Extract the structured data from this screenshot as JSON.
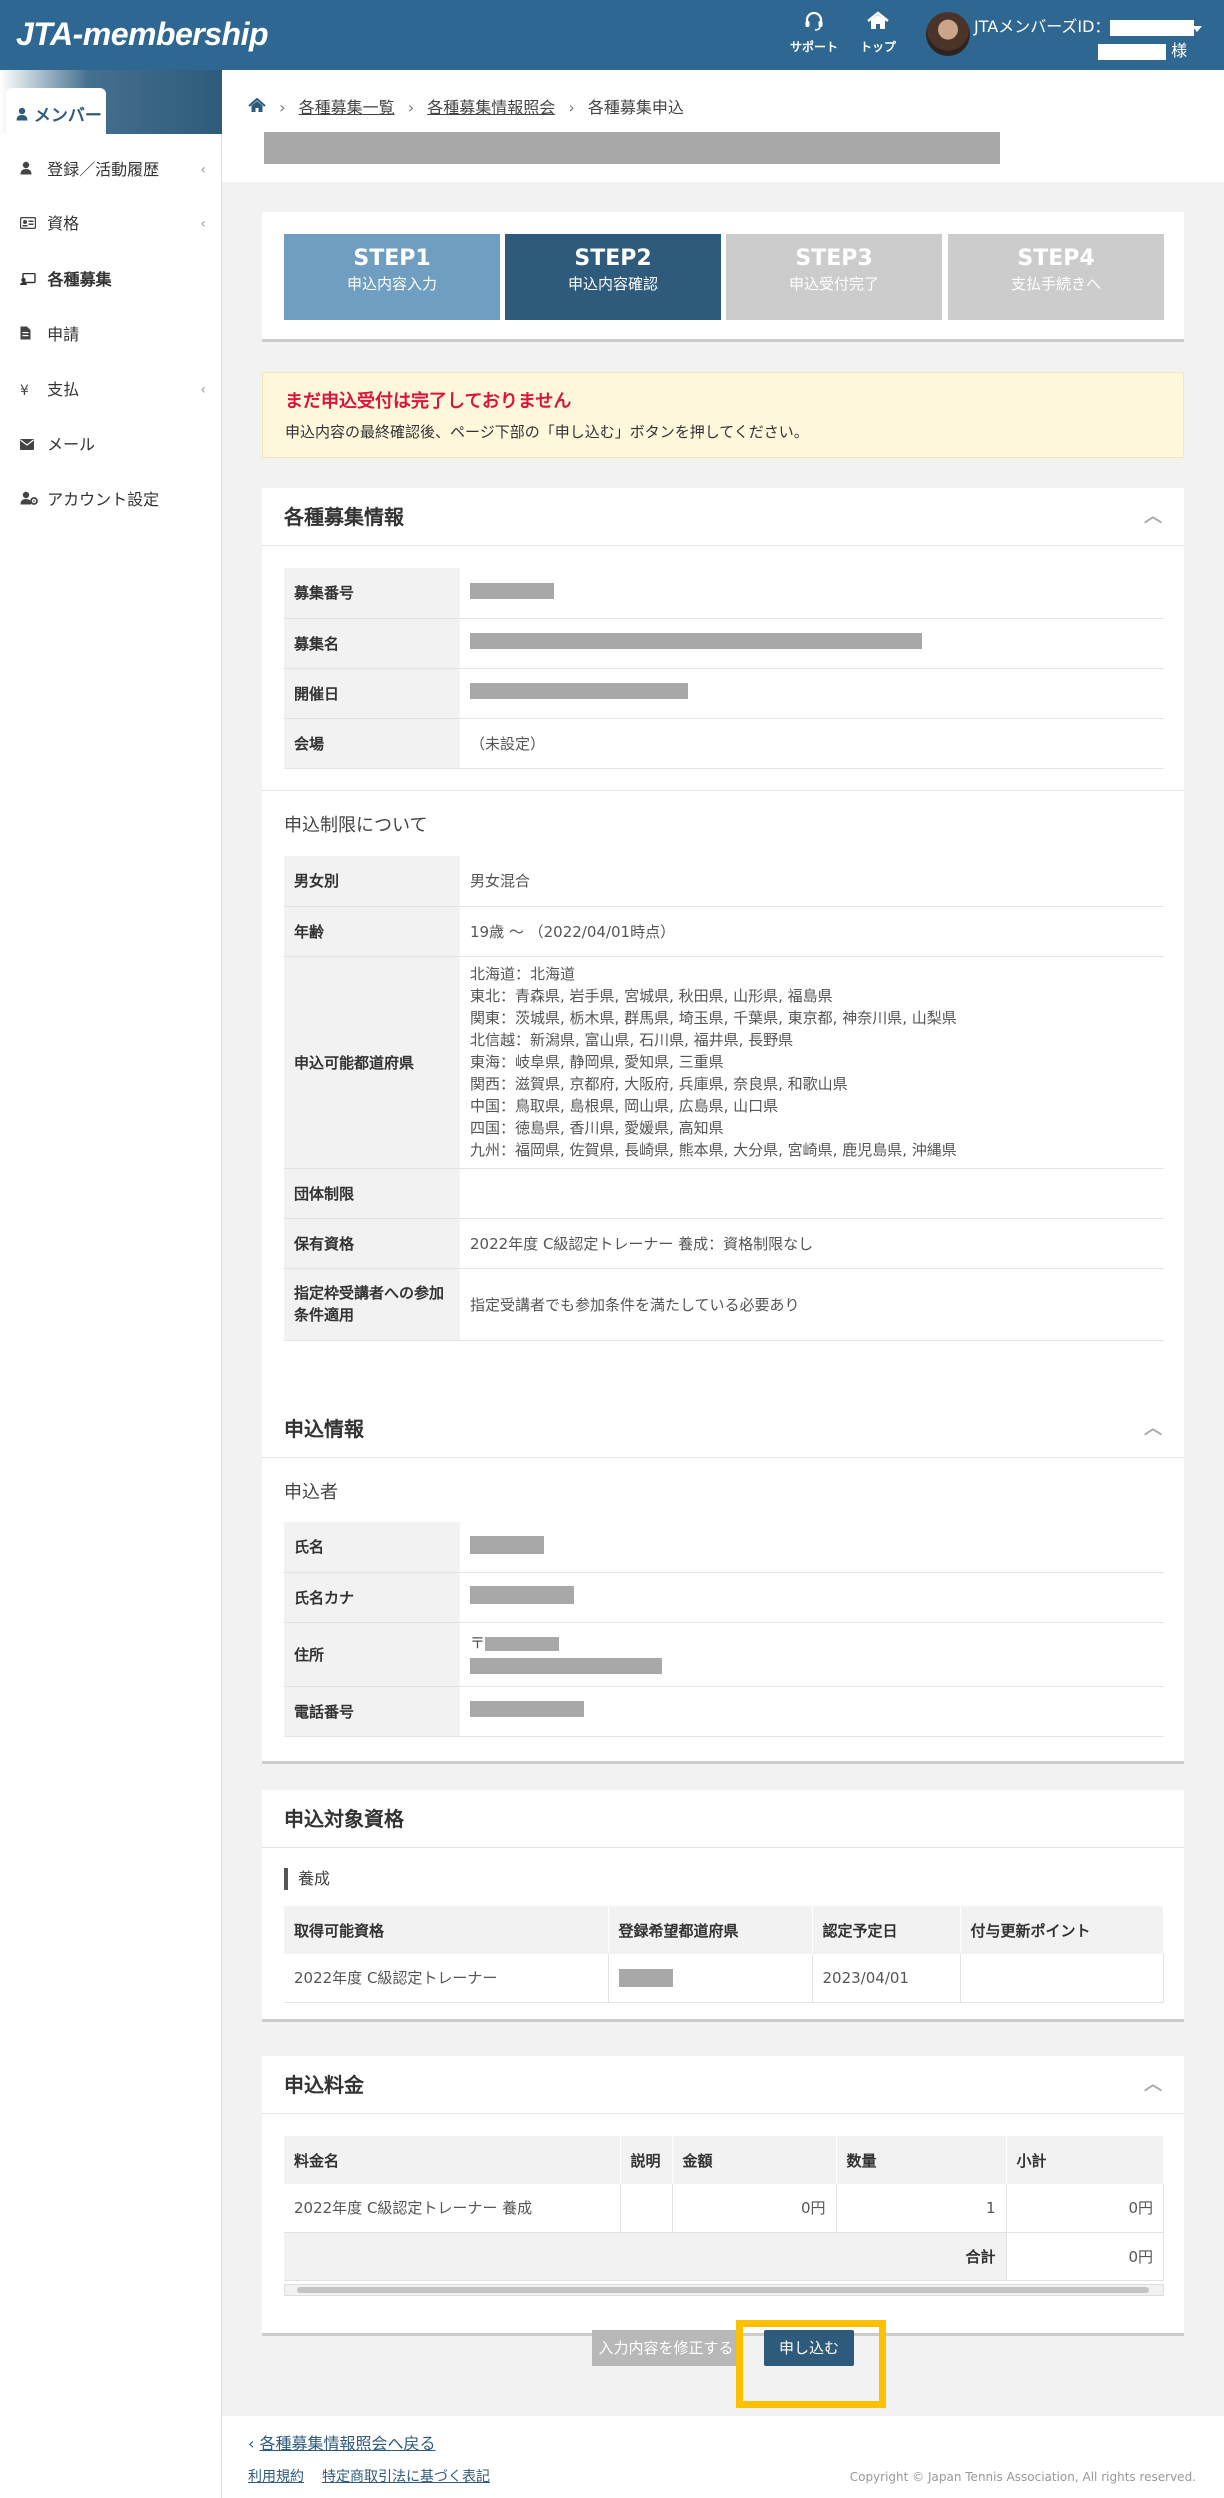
{
  "header": {
    "logo": "JTA-membership",
    "support_label": "サポート",
    "top_label": "トップ",
    "member_id_label": "JTAメンバーズID：",
    "honorific": "様"
  },
  "sidebar": {
    "tab_label": "メンバー",
    "items": [
      {
        "label": "登録／活動履歴",
        "icon": "user-icon"
      },
      {
        "label": "資格",
        "icon": "id-card-icon"
      },
      {
        "label": "各種募集",
        "icon": "recruit-icon"
      },
      {
        "label": "申請",
        "icon": "document-icon"
      },
      {
        "label": "支払",
        "icon": "yen-icon"
      },
      {
        "label": "メール",
        "icon": "envelope-icon"
      },
      {
        "label": "アカウント設定",
        "icon": "user-gear-icon"
      }
    ]
  },
  "breadcrumb": {
    "items": [
      "各種募集一覧",
      "各種募集情報照会",
      "各種募集申込"
    ]
  },
  "steps": [
    {
      "title": "STEP1",
      "subtitle": "申込内容入力",
      "color": "#6f9ec0"
    },
    {
      "title": "STEP2",
      "subtitle": "申込内容確認",
      "color": "#2e5a7c"
    },
    {
      "title": "STEP3",
      "subtitle": "申込受付完了",
      "color": "#cccccc"
    },
    {
      "title": "STEP4",
      "subtitle": "支払手続きへ",
      "color": "#cccccc"
    }
  ],
  "alert": {
    "title": "まだ申込受付は完了しておりません",
    "message": "申込内容の最終確認後、ページ下部の「申し込む」ボタンを押してください。"
  },
  "recruit_info": {
    "heading": "各種募集情報",
    "rows": [
      {
        "label": "募集番号",
        "value": ""
      },
      {
        "label": "募集名",
        "value": ""
      },
      {
        "label": "開催日",
        "value": ""
      },
      {
        "label": "会場",
        "value": "（未設定）"
      }
    ],
    "limits_heading": "申込制限について",
    "limits": {
      "gender_label": "男女別",
      "gender_value": "男女混合",
      "age_label": "年齢",
      "age_value": "19歳 ～ （2022/04/01時点）",
      "pref_label": "申込可能都道府県",
      "prefectures": [
        "北海道：北海道",
        "東北：青森県, 岩手県, 宮城県, 秋田県, 山形県, 福島県",
        "関東：茨城県, 栃木県, 群馬県, 埼玉県, 千葉県, 東京都, 神奈川県, 山梨県",
        "北信越：新潟県, 富山県, 石川県, 福井県, 長野県",
        "東海：岐阜県, 静岡県, 愛知県, 三重県",
        "関西：滋賀県, 京都府, 大阪府, 兵庫県, 奈良県, 和歌山県",
        "中国：鳥取県, 島根県, 岡山県, 広島県, 山口県",
        "四国：徳島県, 香川県, 愛媛県, 高知県",
        "九州：福岡県, 佐賀県, 長崎県, 熊本県, 大分県, 宮崎県, 鹿児島県, 沖縄県"
      ],
      "group_label": "団体制限",
      "group_value": "",
      "qual_label": "保有資格",
      "qual_value": "2022年度 C級認定トレーナー 養成：資格制限なし",
      "designated_label": "指定枠受講者への参加条件適用",
      "designated_value": "指定受講者でも参加条件を満たしている必要あり"
    }
  },
  "applicant": {
    "heading": "申込情報",
    "sub": "申込者",
    "name_label": "氏名",
    "kana_label": "氏名カナ",
    "address_label": "住所",
    "postal_mark": "〒",
    "phone_label": "電話番号"
  },
  "target": {
    "heading": "申込対象資格",
    "category": "養成",
    "columns": [
      "取得可能資格",
      "登録希望都道府県",
      "認定予定日",
      "付与更新ポイント"
    ],
    "row": {
      "qualification": "2022年度 C級認定トレーナー",
      "date": "2023/04/01",
      "points": ""
    }
  },
  "fees": {
    "heading": "申込料金",
    "columns": [
      "料金名",
      "説明",
      "金額",
      "数量",
      "小計"
    ],
    "row": {
      "name": "2022年度 C級認定トレーナー 養成",
      "desc": "",
      "amount": "0円",
      "qty": "1",
      "subtotal": "0円"
    },
    "total_label": "合計",
    "total_value": "0円"
  },
  "actions": {
    "back_label": "入力内容を修正する",
    "submit_label": "申し込む",
    "highlight_color": "#ffc000"
  },
  "footer": {
    "back_link": "各種募集情報照会へ戻る",
    "terms": "利用規約",
    "law": "特定商取引法に基づく表記",
    "copyright": "Copyright © Japan Tennis Association, All rights reserved."
  }
}
